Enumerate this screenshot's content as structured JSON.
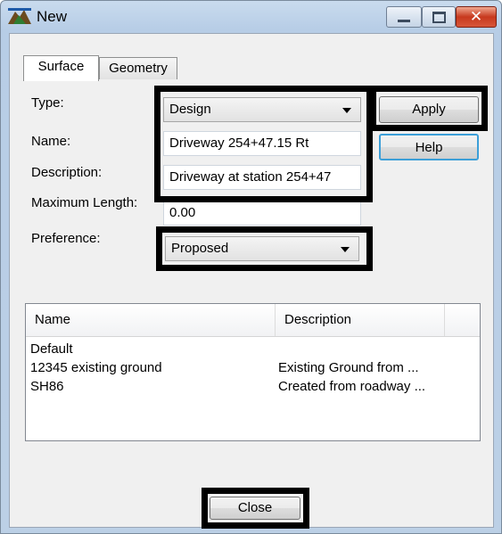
{
  "window": {
    "title": "New"
  },
  "tabs": [
    {
      "label": "Surface"
    },
    {
      "label": "Geometry"
    }
  ],
  "form": {
    "type_label": "Type:",
    "type_value": "Design",
    "name_label": "Name:",
    "name_value": "Driveway 254+47.15 Rt",
    "description_label": "Description:",
    "description_value": "Driveway at station 254+47",
    "max_length_label": "Maximum Length:",
    "max_length_value": "0.00",
    "preference_label": "Preference:",
    "preference_value": "Proposed"
  },
  "buttons": {
    "apply": "Apply",
    "help": "Help",
    "close": "Close"
  },
  "list": {
    "columns": [
      "Name",
      "Description"
    ],
    "rows": [
      {
        "name": "Default",
        "description": ""
      },
      {
        "name": "12345 existing ground",
        "description": "Existing Ground from ..."
      },
      {
        "name": "SH86",
        "description": "Created from roadway ..."
      }
    ]
  },
  "icons": {
    "app": "inroads-app-icon",
    "minimize": "minimize-icon",
    "maximize": "maximize-icon",
    "close": "close-icon"
  },
  "colors": {
    "highlight": "#000000",
    "close_button": "#c7391e",
    "help_focus": "#3c9fd8"
  }
}
